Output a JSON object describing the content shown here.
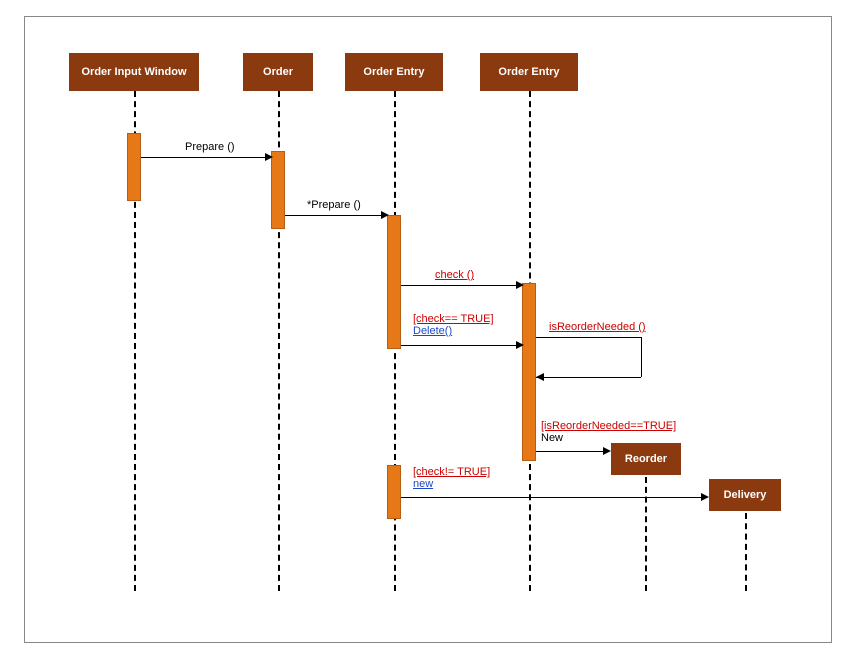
{
  "headers": {
    "orderInputWindow": "Order Input Window",
    "order": "Order",
    "orderEntry1": "Order Entry",
    "orderEntry2": "Order Entry"
  },
  "messages": {
    "prepare": "Prepare ()",
    "starPrepare": "*Prepare ()",
    "check": "check ()",
    "checkTrue": "[check== TRUE]",
    "delete": "Delete()",
    "isReorderNeeded": "isReorderNeeded ()",
    "isReorderTrue": "[isReorderNeeded==TRUE]",
    "new1": "New",
    "checkNotTrue": "[check!= TRUE]",
    "new2": "new"
  },
  "boxes": {
    "reorder": "Reorder",
    "delivery": "Delivery"
  },
  "chart_data": {
    "type": "sequence-diagram",
    "title": "",
    "participants": [
      {
        "id": "p1",
        "name": "Order Input Window"
      },
      {
        "id": "p2",
        "name": "Order"
      },
      {
        "id": "p3",
        "name": "Order Entry"
      },
      {
        "id": "p4",
        "name": "Order Entry"
      }
    ],
    "messages": [
      {
        "from": "p1",
        "to": "p2",
        "label": "Prepare ()",
        "type": "call"
      },
      {
        "from": "p2",
        "to": "p3",
        "label": "*Prepare ()",
        "type": "call"
      },
      {
        "from": "p3",
        "to": "p4",
        "label": "check ()",
        "type": "call"
      },
      {
        "from": "p3",
        "to": "p4",
        "label": "[check== TRUE] Delete()",
        "type": "call",
        "guard": "check== TRUE"
      },
      {
        "from": "p4",
        "to": "p4",
        "label": "isReorderNeeded ()",
        "type": "self-call"
      },
      {
        "from": "p4",
        "to": "Reorder",
        "label": "[isReorderNeeded==TRUE] New",
        "type": "create",
        "guard": "isReorderNeeded==TRUE"
      },
      {
        "from": "p3",
        "to": "Delivery",
        "label": "[check!= TRUE] new",
        "type": "create",
        "guard": "check!= TRUE"
      }
    ],
    "created_objects": [
      "Reorder",
      "Delivery"
    ]
  }
}
